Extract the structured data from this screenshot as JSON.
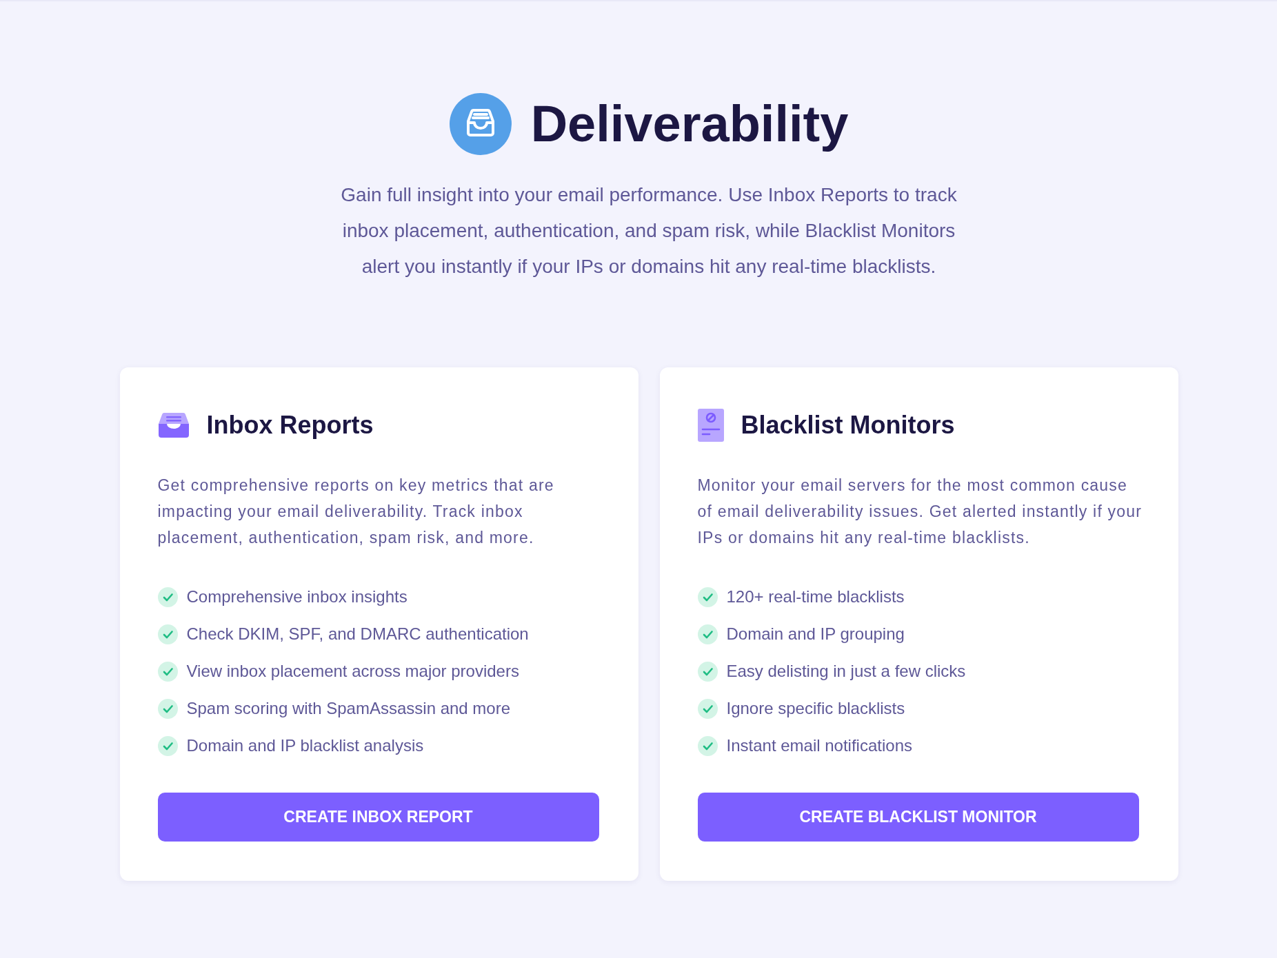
{
  "header": {
    "title": "Deliverability",
    "description": "Gain full insight into your email performance. Use Inbox Reports to track inbox placement, authentication, and spam risk, while Blacklist Monitors alert you instantly if your IPs or domains hit any real-time blacklists."
  },
  "cards": [
    {
      "kind": "inbox",
      "title": "Inbox Reports",
      "description": "Get comprehensive reports on key metrics that are impacting your email deliverability. Track inbox placement, authentication, spam risk, and more.",
      "features": [
        "Comprehensive inbox insights",
        "Check DKIM, SPF, and DMARC authentication",
        "View inbox placement across major providers",
        "Spam scoring with SpamAssassin and more",
        "Domain and IP blacklist analysis"
      ],
      "button": "CREATE INBOX REPORT"
    },
    {
      "kind": "blacklist",
      "title": "Blacklist Monitors",
      "description": "Monitor your email servers for the most common cause of email deliverability issues. Get alerted instantly if your IPs or domains hit any real-time blacklists.",
      "features": [
        "120+ real-time blacklists",
        "Domain and IP grouping",
        "Easy delisting in just a few clicks",
        "Ignore specific blacklists",
        "Instant email notifications"
      ],
      "button": "CREATE BLACKLIST MONITOR"
    }
  ]
}
